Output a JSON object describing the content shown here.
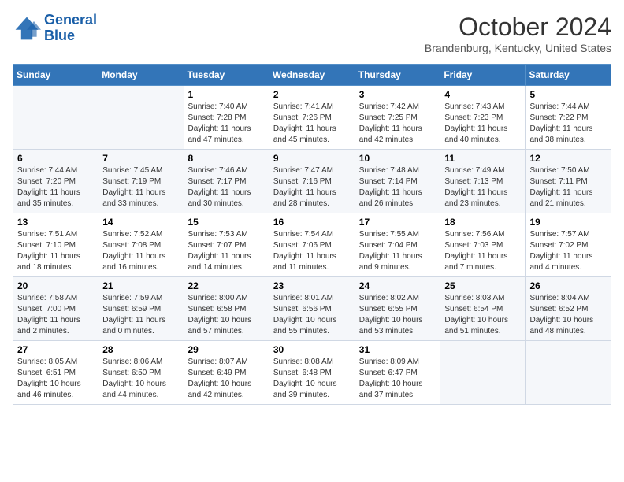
{
  "header": {
    "logo_line1": "General",
    "logo_line2": "Blue",
    "month_title": "October 2024",
    "subtitle": "Brandenburg, Kentucky, United States"
  },
  "weekdays": [
    "Sunday",
    "Monday",
    "Tuesday",
    "Wednesday",
    "Thursday",
    "Friday",
    "Saturday"
  ],
  "weeks": [
    [
      {
        "day": "",
        "sunrise": "",
        "sunset": "",
        "daylight": ""
      },
      {
        "day": "",
        "sunrise": "",
        "sunset": "",
        "daylight": ""
      },
      {
        "day": "1",
        "sunrise": "Sunrise: 7:40 AM",
        "sunset": "Sunset: 7:28 PM",
        "daylight": "Daylight: 11 hours and 47 minutes."
      },
      {
        "day": "2",
        "sunrise": "Sunrise: 7:41 AM",
        "sunset": "Sunset: 7:26 PM",
        "daylight": "Daylight: 11 hours and 45 minutes."
      },
      {
        "day": "3",
        "sunrise": "Sunrise: 7:42 AM",
        "sunset": "Sunset: 7:25 PM",
        "daylight": "Daylight: 11 hours and 42 minutes."
      },
      {
        "day": "4",
        "sunrise": "Sunrise: 7:43 AM",
        "sunset": "Sunset: 7:23 PM",
        "daylight": "Daylight: 11 hours and 40 minutes."
      },
      {
        "day": "5",
        "sunrise": "Sunrise: 7:44 AM",
        "sunset": "Sunset: 7:22 PM",
        "daylight": "Daylight: 11 hours and 38 minutes."
      }
    ],
    [
      {
        "day": "6",
        "sunrise": "Sunrise: 7:44 AM",
        "sunset": "Sunset: 7:20 PM",
        "daylight": "Daylight: 11 hours and 35 minutes."
      },
      {
        "day": "7",
        "sunrise": "Sunrise: 7:45 AM",
        "sunset": "Sunset: 7:19 PM",
        "daylight": "Daylight: 11 hours and 33 minutes."
      },
      {
        "day": "8",
        "sunrise": "Sunrise: 7:46 AM",
        "sunset": "Sunset: 7:17 PM",
        "daylight": "Daylight: 11 hours and 30 minutes."
      },
      {
        "day": "9",
        "sunrise": "Sunrise: 7:47 AM",
        "sunset": "Sunset: 7:16 PM",
        "daylight": "Daylight: 11 hours and 28 minutes."
      },
      {
        "day": "10",
        "sunrise": "Sunrise: 7:48 AM",
        "sunset": "Sunset: 7:14 PM",
        "daylight": "Daylight: 11 hours and 26 minutes."
      },
      {
        "day": "11",
        "sunrise": "Sunrise: 7:49 AM",
        "sunset": "Sunset: 7:13 PM",
        "daylight": "Daylight: 11 hours and 23 minutes."
      },
      {
        "day": "12",
        "sunrise": "Sunrise: 7:50 AM",
        "sunset": "Sunset: 7:11 PM",
        "daylight": "Daylight: 11 hours and 21 minutes."
      }
    ],
    [
      {
        "day": "13",
        "sunrise": "Sunrise: 7:51 AM",
        "sunset": "Sunset: 7:10 PM",
        "daylight": "Daylight: 11 hours and 18 minutes."
      },
      {
        "day": "14",
        "sunrise": "Sunrise: 7:52 AM",
        "sunset": "Sunset: 7:08 PM",
        "daylight": "Daylight: 11 hours and 16 minutes."
      },
      {
        "day": "15",
        "sunrise": "Sunrise: 7:53 AM",
        "sunset": "Sunset: 7:07 PM",
        "daylight": "Daylight: 11 hours and 14 minutes."
      },
      {
        "day": "16",
        "sunrise": "Sunrise: 7:54 AM",
        "sunset": "Sunset: 7:06 PM",
        "daylight": "Daylight: 11 hours and 11 minutes."
      },
      {
        "day": "17",
        "sunrise": "Sunrise: 7:55 AM",
        "sunset": "Sunset: 7:04 PM",
        "daylight": "Daylight: 11 hours and 9 minutes."
      },
      {
        "day": "18",
        "sunrise": "Sunrise: 7:56 AM",
        "sunset": "Sunset: 7:03 PM",
        "daylight": "Daylight: 11 hours and 7 minutes."
      },
      {
        "day": "19",
        "sunrise": "Sunrise: 7:57 AM",
        "sunset": "Sunset: 7:02 PM",
        "daylight": "Daylight: 11 hours and 4 minutes."
      }
    ],
    [
      {
        "day": "20",
        "sunrise": "Sunrise: 7:58 AM",
        "sunset": "Sunset: 7:00 PM",
        "daylight": "Daylight: 11 hours and 2 minutes."
      },
      {
        "day": "21",
        "sunrise": "Sunrise: 7:59 AM",
        "sunset": "Sunset: 6:59 PM",
        "daylight": "Daylight: 11 hours and 0 minutes."
      },
      {
        "day": "22",
        "sunrise": "Sunrise: 8:00 AM",
        "sunset": "Sunset: 6:58 PM",
        "daylight": "Daylight: 10 hours and 57 minutes."
      },
      {
        "day": "23",
        "sunrise": "Sunrise: 8:01 AM",
        "sunset": "Sunset: 6:56 PM",
        "daylight": "Daylight: 10 hours and 55 minutes."
      },
      {
        "day": "24",
        "sunrise": "Sunrise: 8:02 AM",
        "sunset": "Sunset: 6:55 PM",
        "daylight": "Daylight: 10 hours and 53 minutes."
      },
      {
        "day": "25",
        "sunrise": "Sunrise: 8:03 AM",
        "sunset": "Sunset: 6:54 PM",
        "daylight": "Daylight: 10 hours and 51 minutes."
      },
      {
        "day": "26",
        "sunrise": "Sunrise: 8:04 AM",
        "sunset": "Sunset: 6:52 PM",
        "daylight": "Daylight: 10 hours and 48 minutes."
      }
    ],
    [
      {
        "day": "27",
        "sunrise": "Sunrise: 8:05 AM",
        "sunset": "Sunset: 6:51 PM",
        "daylight": "Daylight: 10 hours and 46 minutes."
      },
      {
        "day": "28",
        "sunrise": "Sunrise: 8:06 AM",
        "sunset": "Sunset: 6:50 PM",
        "daylight": "Daylight: 10 hours and 44 minutes."
      },
      {
        "day": "29",
        "sunrise": "Sunrise: 8:07 AM",
        "sunset": "Sunset: 6:49 PM",
        "daylight": "Daylight: 10 hours and 42 minutes."
      },
      {
        "day": "30",
        "sunrise": "Sunrise: 8:08 AM",
        "sunset": "Sunset: 6:48 PM",
        "daylight": "Daylight: 10 hours and 39 minutes."
      },
      {
        "day": "31",
        "sunrise": "Sunrise: 8:09 AM",
        "sunset": "Sunset: 6:47 PM",
        "daylight": "Daylight: 10 hours and 37 minutes."
      },
      {
        "day": "",
        "sunrise": "",
        "sunset": "",
        "daylight": ""
      },
      {
        "day": "",
        "sunrise": "",
        "sunset": "",
        "daylight": ""
      }
    ]
  ]
}
